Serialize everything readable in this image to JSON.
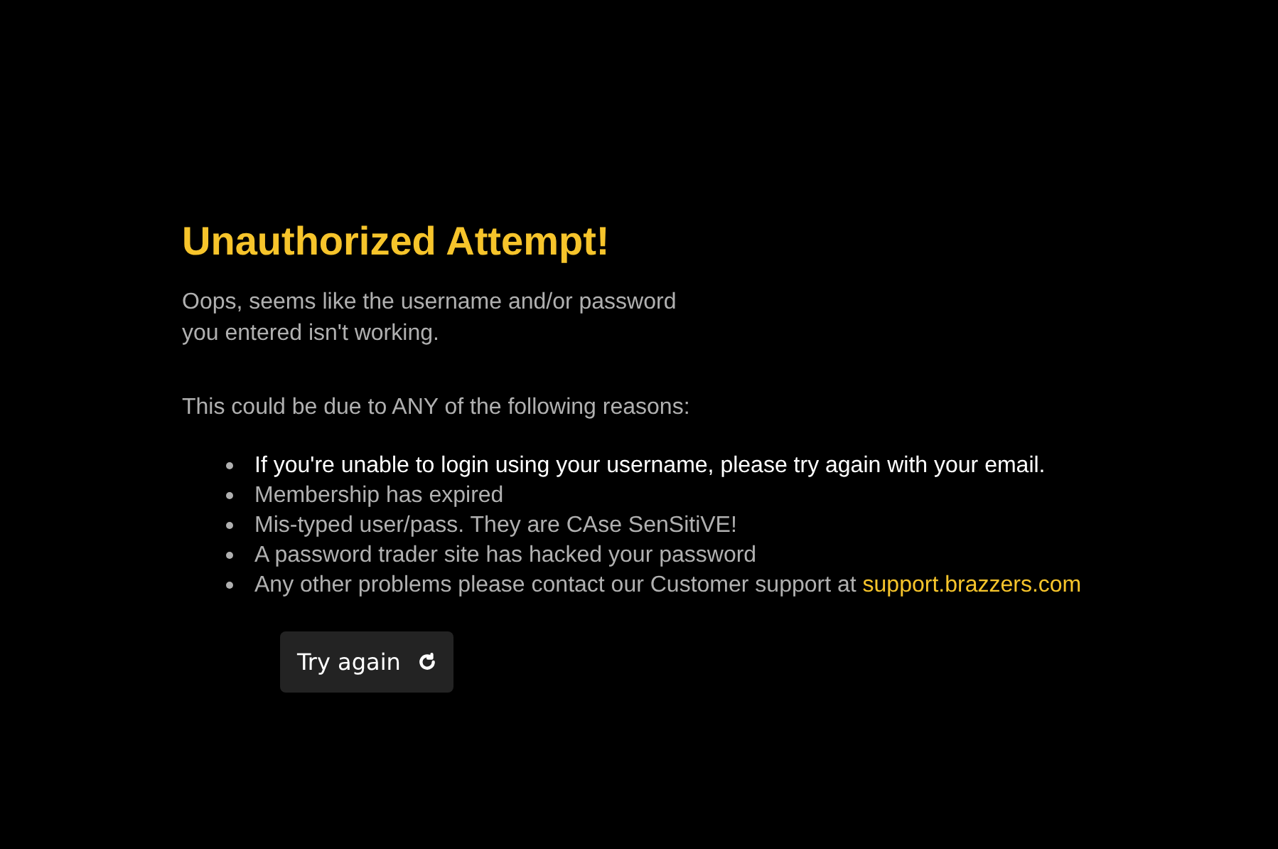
{
  "title": "Unauthorized Attempt!",
  "message_lines": [
    "Oops, seems like the username and/or password",
    "you entered isn't working."
  ],
  "reasons_intro": "This could be due to ANY of the following reasons:",
  "reasons": [
    {
      "text": "If you're unable to login using your username, please try again with your email.",
      "highlighted": true
    },
    {
      "text": "Membership has expired",
      "highlighted": false
    },
    {
      "text": "Mis-typed user/pass. They are CAse SenSitiVE!",
      "highlighted": false
    },
    {
      "text": "A password trader site has hacked your password",
      "highlighted": false
    },
    {
      "text": "Any other problems please contact our Customer support at",
      "highlighted": false,
      "link": "support.brazzers.com"
    }
  ],
  "button": {
    "label": "Try again"
  }
}
